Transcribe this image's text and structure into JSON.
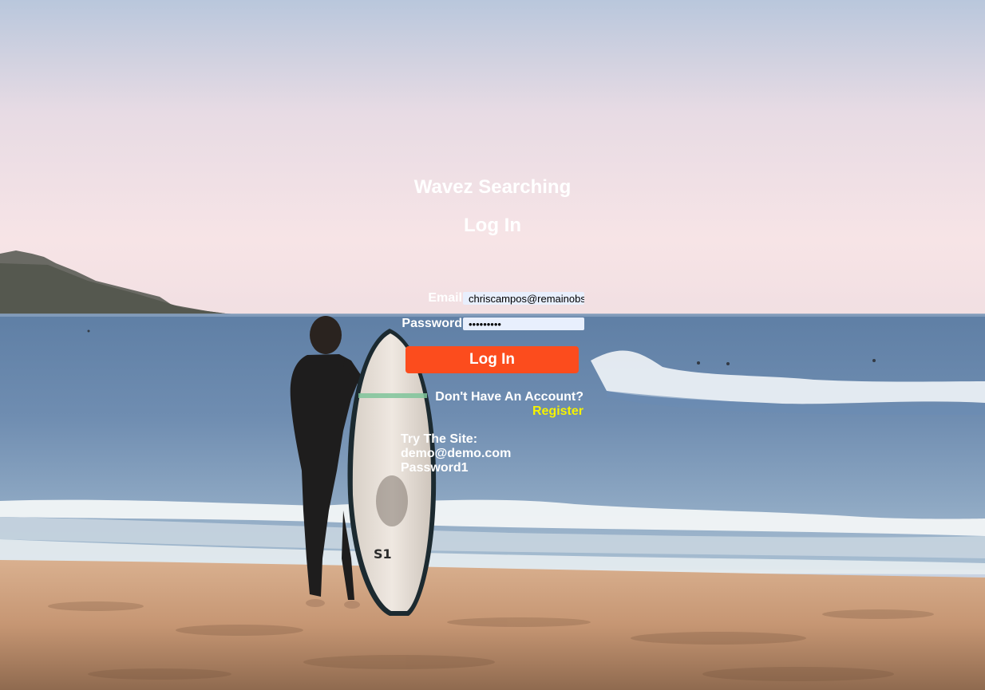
{
  "site": {
    "title": "Wavez Searching"
  },
  "login_form": {
    "heading": "Log In",
    "email_label": "Email",
    "email_value": "chriscampos@remainobscured.com",
    "password_label": "Password",
    "password_value": "Password1",
    "submit_label": "Log In"
  },
  "register": {
    "prompt": "Don't Have An Account?",
    "link_label": "Register"
  },
  "demo": {
    "heading": "Try The Site:",
    "email": "demo@demo.com",
    "password": "Password1"
  },
  "colors": {
    "button": "#fc4c1d",
    "register_link": "#f5f200",
    "input_background": "#e8effd"
  }
}
